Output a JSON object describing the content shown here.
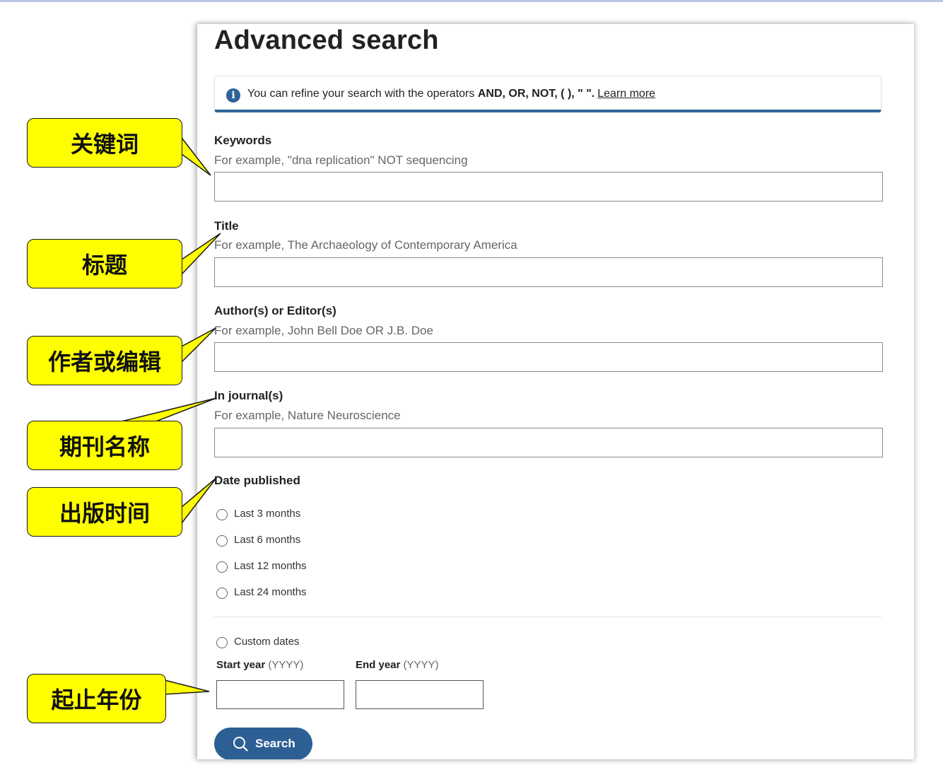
{
  "page": {
    "title": "Advanced search",
    "info": {
      "icon": "info-icon",
      "text": "You can refine your search with the operators",
      "operators": "AND, OR, NOT, ( ), \" \".",
      "link": "Learn more"
    }
  },
  "fields": {
    "keywords": {
      "label": "Keywords",
      "hint": "For example, \"dna replication\" NOT sequencing",
      "value": ""
    },
    "title": {
      "label": "Title",
      "hint": "For example, The Archaeology of Contemporary America",
      "value": ""
    },
    "authors": {
      "label": "Author(s) or Editor(s)",
      "hint": "For example, John Bell Doe OR J.B. Doe",
      "value": ""
    },
    "journals": {
      "label": "In journal(s)",
      "hint": "For example, Nature Neuroscience",
      "value": ""
    }
  },
  "date": {
    "label": "Date published",
    "options": [
      "Last 3 months",
      "Last 6 months",
      "Last 12 months",
      "Last 24 months"
    ],
    "custom": "Custom dates",
    "start_label": "Start year",
    "end_label": "End year",
    "format": "(YYYY)"
  },
  "search_button": {
    "label": "Search",
    "icon": "search-icon"
  },
  "annotations": {
    "keywords": "关键词",
    "title": "标题",
    "authors": "作者或编辑",
    "journals": "期刊名称",
    "date": "出版时间",
    "years": "起止年份"
  },
  "colors": {
    "accent": "#2d5f95",
    "callout": "#ffff00"
  }
}
